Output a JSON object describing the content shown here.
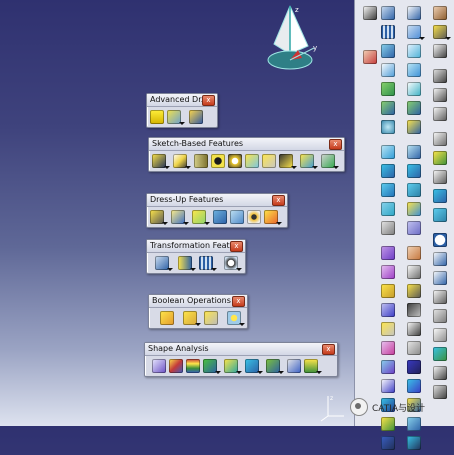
{
  "toolbars": {
    "advanced": {
      "title": "Advanced Dr...",
      "close": "x",
      "icons": [
        "cylinder-icon",
        "multi-sided-pad-icon",
        "solid-box-icon"
      ]
    },
    "sketch": {
      "title": "Sketch-Based Features",
      "close": "x",
      "icons": [
        "pad-icon",
        "pocket-icon",
        "shaft-icon",
        "hole-icon",
        "groove-icon",
        "rib-icon",
        "slot-icon",
        "stiffener-icon",
        "loft-icon"
      ]
    },
    "dressup": {
      "title": "Dress-Up Features",
      "close": "x",
      "icons": [
        "edge-fillet-icon",
        "chamfer-icon",
        "draft-icon",
        "shell-icon",
        "thickness-icon",
        "thread-icon",
        "remove-face-icon"
      ]
    },
    "transform": {
      "title": "Transformation Feat...",
      "close": "x",
      "icons": [
        "translation-icon",
        "mirror-icon",
        "rect-pattern-icon",
        "scaling-icon"
      ]
    },
    "boolean": {
      "title": "Boolean Operations",
      "close": "x",
      "icons": [
        "assemble-icon",
        "add-icon",
        "remove-lump-icon",
        "intersect-icon"
      ]
    },
    "shape": {
      "title": "Shape Analysis",
      "close": "x",
      "icons": [
        "curve-analysis-icon",
        "connect-checker-icon",
        "draft-analysis-icon",
        "curvature-analysis-icon",
        "distance-analysis-icon",
        "surface-curvature-icon",
        "porcupine-icon",
        "light-icon",
        "isophote-icon"
      ]
    }
  },
  "watermark": {
    "text": "CATIA与设计"
  },
  "colors": {
    "background_top": "#2f3170",
    "background_bottom": "#dde2ef",
    "panel": "#e5e7ef",
    "close": "#c53b1c"
  }
}
